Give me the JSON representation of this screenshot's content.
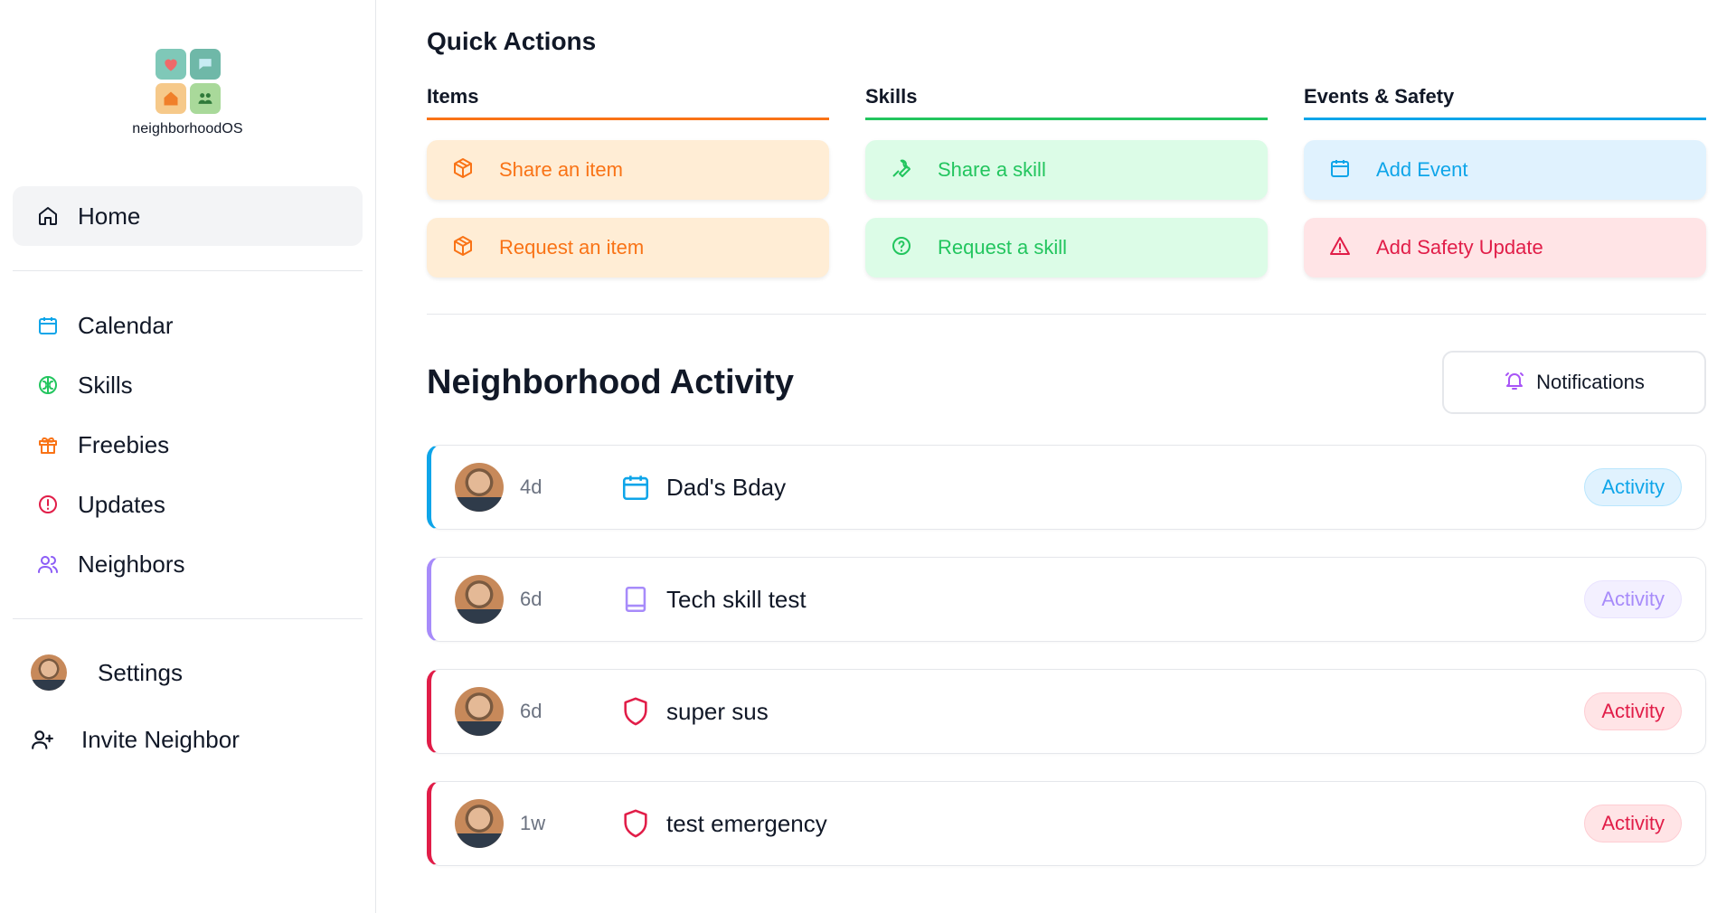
{
  "app": {
    "name": "neighborhoodOS"
  },
  "sidebar": {
    "home": {
      "label": "Home",
      "icon": "home-icon"
    },
    "items": [
      {
        "label": "Calendar",
        "icon": "calendar-icon",
        "color": "#0ea5e9"
      },
      {
        "label": "Skills",
        "icon": "brain-icon",
        "color": "#22c55e"
      },
      {
        "label": "Freebies",
        "icon": "gift-icon",
        "color": "#f97316"
      },
      {
        "label": "Updates",
        "icon": "info-icon",
        "color": "#e11d48"
      },
      {
        "label": "Neighbors",
        "icon": "users-icon",
        "color": "#8b5cf6"
      }
    ],
    "settings": {
      "label": "Settings"
    },
    "invite": {
      "label": "Invite Neighbor",
      "icon": "user-plus-icon"
    }
  },
  "quick_actions": {
    "title": "Quick Actions",
    "columns": [
      {
        "title": "Items",
        "color": "#f97316",
        "buttons": [
          {
            "label": "Share an item",
            "icon": "package-icon"
          },
          {
            "label": "Request an item",
            "icon": "package-icon"
          }
        ]
      },
      {
        "title": "Skills",
        "color": "#22c55e",
        "buttons": [
          {
            "label": "Share a skill",
            "icon": "wrench-icon"
          },
          {
            "label": "Request a skill",
            "icon": "help-circle-icon"
          }
        ]
      },
      {
        "title": "Events & Safety",
        "color": "#0ea5e9",
        "buttons": [
          {
            "label": "Add Event",
            "icon": "calendar-icon"
          },
          {
            "label": "Add Safety Update",
            "icon": "alert-triangle-icon"
          }
        ]
      }
    ]
  },
  "activity": {
    "title": "Neighborhood Activity",
    "notifications_label": "Notifications",
    "items": [
      {
        "time": "4d",
        "name": "Dad's Bday",
        "icon": "calendar-icon",
        "badge": "Activity",
        "color": "#0ea5e9"
      },
      {
        "time": "6d",
        "name": "Tech skill test",
        "icon": "book-icon",
        "badge": "Activity",
        "color": "#a78bfa"
      },
      {
        "time": "6d",
        "name": "super sus",
        "icon": "shield-icon",
        "badge": "Activity",
        "color": "#e11d48"
      },
      {
        "time": "1w",
        "name": "test emergency",
        "icon": "shield-icon",
        "badge": "Activity",
        "color": "#e11d48"
      }
    ]
  }
}
